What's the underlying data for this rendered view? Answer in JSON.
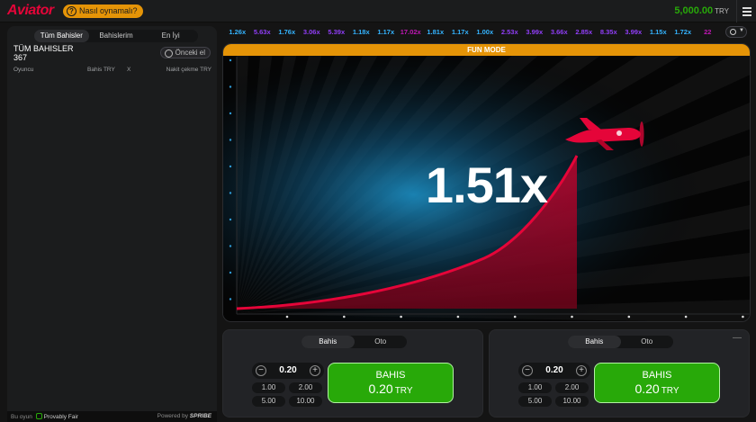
{
  "header": {
    "logo_text": "Aviator",
    "how_to_play_label": "Nasıl oynamalı?",
    "balance_value": "5,000.00",
    "balance_currency": "TRY",
    "menu_icon": "hamburger-menu-icon"
  },
  "left_panel": {
    "tabs": [
      "Tüm Bahisler",
      "Bahislerim",
      "En İyi"
    ],
    "active_tab": "Tüm Bahisler",
    "title": "TÜM BAHISLER",
    "count": "367",
    "previous_hand_label": "Önceki el",
    "columns": {
      "player": "Oyuncu",
      "bet": "Bahis TRY",
      "x": "X",
      "cashout": "Nakit çekme TRY"
    },
    "footer": {
      "this_game": "Bu oyun",
      "provably_fair": "Provably Fair",
      "powered_by": "Powered by",
      "brand": "SPRIBE"
    }
  },
  "history": [
    {
      "value": "1.26x",
      "color": "#34b4ff"
    },
    {
      "value": "5.63x",
      "color": "#913ef8"
    },
    {
      "value": "1.76x",
      "color": "#34b4ff"
    },
    {
      "value": "3.06x",
      "color": "#913ef8"
    },
    {
      "value": "5.39x",
      "color": "#913ef8"
    },
    {
      "value": "1.18x",
      "color": "#34b4ff"
    },
    {
      "value": "1.17x",
      "color": "#34b4ff"
    },
    {
      "value": "17.02x",
      "color": "#c017b4"
    },
    {
      "value": "1.81x",
      "color": "#34b4ff"
    },
    {
      "value": "1.17x",
      "color": "#34b4ff"
    },
    {
      "value": "1.00x",
      "color": "#34b4ff"
    },
    {
      "value": "2.53x",
      "color": "#913ef8"
    },
    {
      "value": "3.99x",
      "color": "#913ef8"
    },
    {
      "value": "3.66x",
      "color": "#913ef8"
    },
    {
      "value": "2.85x",
      "color": "#913ef8"
    },
    {
      "value": "8.35x",
      "color": "#913ef8"
    },
    {
      "value": "3.99x",
      "color": "#913ef8"
    },
    {
      "value": "1.15x",
      "color": "#34b4ff"
    },
    {
      "value": "1.72x",
      "color": "#34b4ff"
    },
    {
      "value": "22",
      "color": "#c017b4"
    }
  ],
  "stage": {
    "fun_mode_label": "FUN MODE",
    "multiplier": "1.51x",
    "accent_color": "#e50539",
    "plane_icon": "red-plane-icon"
  },
  "bet_panels": [
    {
      "tabs": [
        "Bahis",
        "Oto"
      ],
      "active_tab": "Bahis",
      "amount": "0.20",
      "quick_amounts": [
        "1.00",
        "2.00",
        "5.00",
        "10.00"
      ],
      "button_label": "BAHIS",
      "button_amount": "0.20",
      "button_currency": "TRY",
      "show_more": false
    },
    {
      "tabs": [
        "Bahis",
        "Oto"
      ],
      "active_tab": "Bahis",
      "amount": "0.20",
      "quick_amounts": [
        "1.00",
        "2.00",
        "5.00",
        "10.00"
      ],
      "button_label": "BAHIS",
      "button_amount": "0.20",
      "button_currency": "TRY",
      "show_more": true,
      "more_label": "—"
    }
  ]
}
